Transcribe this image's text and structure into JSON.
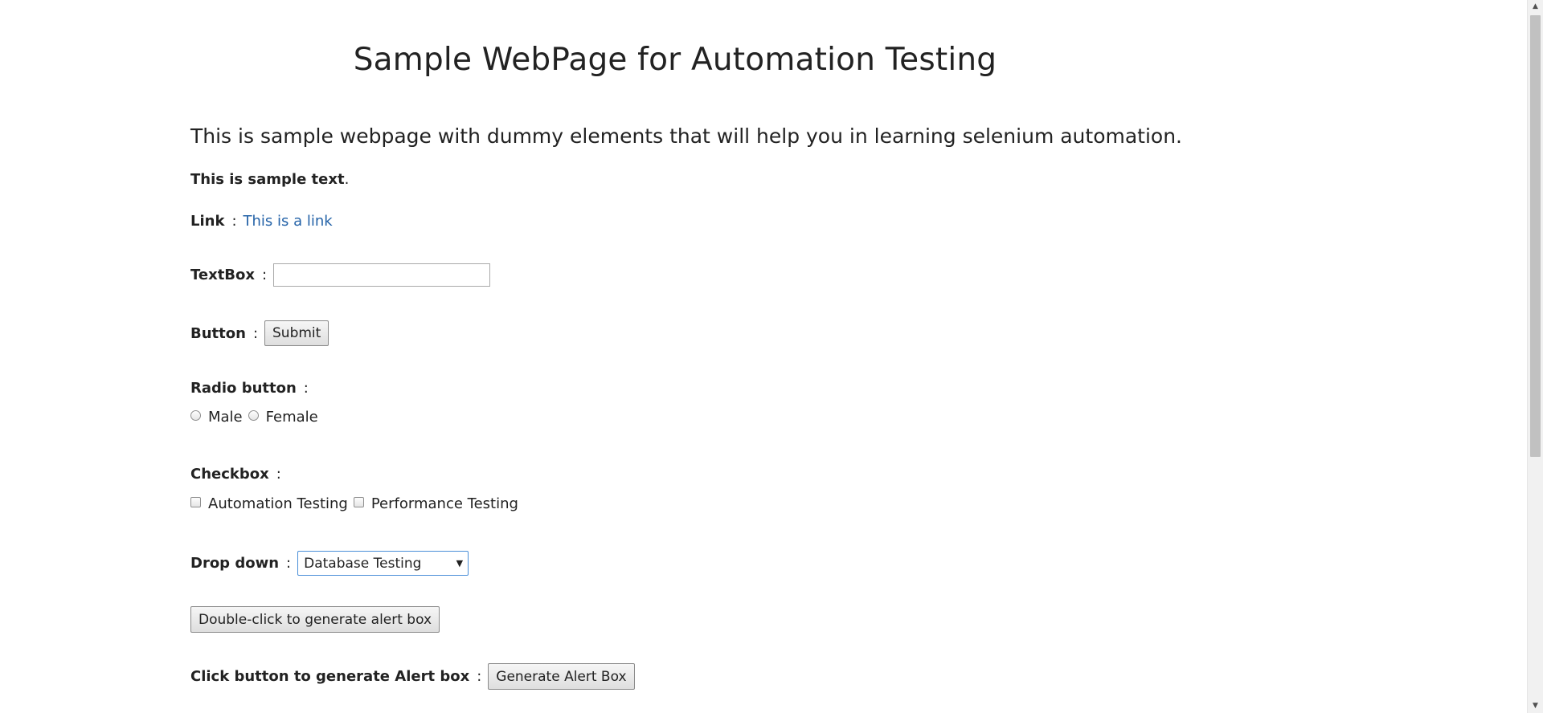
{
  "header": {
    "title": "Sample WebPage for Automation Testing"
  },
  "intro": "This is sample webpage with dummy elements that will help you in learning selenium automation.",
  "sample_text": {
    "bold": "This is sample text",
    "dot": "."
  },
  "link_row": {
    "label": "Link",
    "colon": ":",
    "link_text": "This is a link"
  },
  "textbox_row": {
    "label": "TextBox",
    "colon": ":",
    "value": "",
    "placeholder": ""
  },
  "button_row": {
    "label": "Button",
    "colon": ":",
    "submit_label": "Submit"
  },
  "radio": {
    "label": "Radio button",
    "colon": ":",
    "options": [
      "Male",
      "Female"
    ]
  },
  "checkbox": {
    "label": "Checkbox",
    "colon": ":",
    "options": [
      "Automation Testing",
      "Performance Testing"
    ]
  },
  "dropdown": {
    "label": "Drop down",
    "colon": ":",
    "selected": "Database Testing"
  },
  "dblclick": {
    "button_label": "Double-click to generate alert box"
  },
  "alert_row": {
    "label": "Click button to generate Alert box",
    "colon": ":",
    "button_label": "Generate Alert Box"
  },
  "colors": {
    "link": "#2563a8",
    "select_border": "#4a8fd8",
    "text": "#222222"
  }
}
